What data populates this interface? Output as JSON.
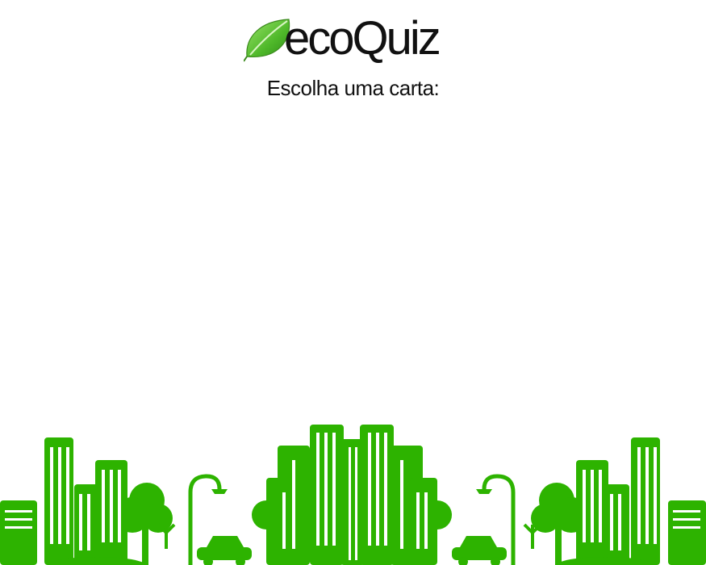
{
  "brand": {
    "logo_text": "ecoQuiz",
    "logo_icon": "leaf-icon",
    "primary_color": "#2db300",
    "leaf_color": "#6cc83f"
  },
  "main": {
    "prompt": "Escolha uma carta:"
  },
  "footer": {
    "illustration": "green-city-skyline"
  }
}
